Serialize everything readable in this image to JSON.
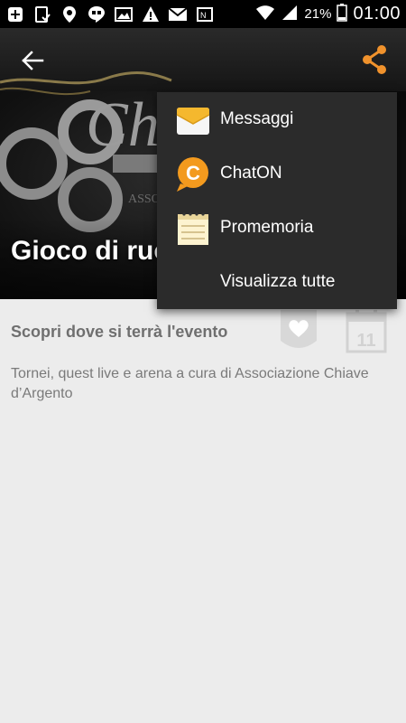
{
  "status_bar": {
    "battery_percent": "21%",
    "time": "01:00",
    "icons": [
      "plus-box-icon",
      "tablet-check-icon",
      "location-pin-icon",
      "hangouts-icon",
      "image-icon",
      "warning-icon",
      "mail-icon",
      "nfc-icon",
      "wifi-icon",
      "signal-icon",
      "battery-icon"
    ]
  },
  "header": {
    "title": "Gioco di ruo",
    "back_icon": "arrow-left-icon",
    "share_icon": "share-icon",
    "accent_color": "#f0922c"
  },
  "content": {
    "subtitle": "Scopri dove si terrà l'evento",
    "description": "Tornei, quest live e arena a cura di Associazione Chiave d’Argento",
    "calendar_day": "11"
  },
  "share_menu": {
    "items": [
      {
        "label": "Messaggi",
        "icon": "messages-icon"
      },
      {
        "label": "ChatON",
        "icon": "chaton-icon"
      },
      {
        "label": "Promemoria",
        "icon": "memo-icon"
      },
      {
        "label": "Visualizza tutte",
        "icon": ""
      }
    ]
  }
}
